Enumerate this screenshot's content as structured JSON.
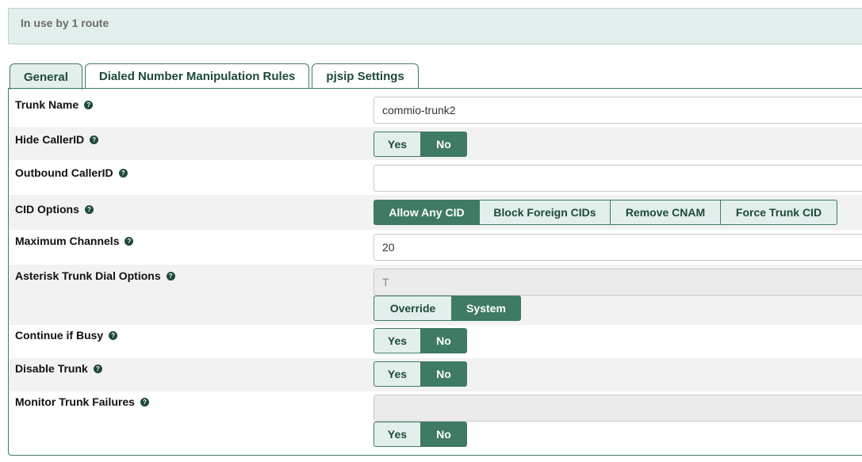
{
  "banner": {
    "text": "In use by 1 route"
  },
  "tabs": [
    {
      "label": "General",
      "active": true
    },
    {
      "label": "Dialed Number Manipulation Rules",
      "active": false
    },
    {
      "label": "pjsip Settings",
      "active": false
    }
  ],
  "help_glyph": "?",
  "fields": {
    "trunk_name": {
      "label": "Trunk Name",
      "value": "commio-trunk2"
    },
    "hide_callerid": {
      "label": "Hide CallerID",
      "options": [
        "Yes",
        "No"
      ],
      "selected": "No"
    },
    "outbound_callerid": {
      "label": "Outbound CallerID",
      "value": ""
    },
    "cid_options": {
      "label": "CID Options",
      "options": [
        "Allow Any CID",
        "Block Foreign CIDs",
        "Remove CNAM",
        "Force Trunk CID"
      ],
      "selected": "Allow Any CID"
    },
    "max_channels": {
      "label": "Maximum Channels",
      "value": "20"
    },
    "dial_options": {
      "label": "Asterisk Trunk Dial Options",
      "value": "T",
      "options": [
        "Override",
        "System"
      ],
      "selected": "System"
    },
    "continue_if_busy": {
      "label": "Continue if Busy",
      "options": [
        "Yes",
        "No"
      ],
      "selected": "No"
    },
    "disable_trunk": {
      "label": "Disable Trunk",
      "options": [
        "Yes",
        "No"
      ],
      "selected": "No"
    },
    "monitor_failures": {
      "label": "Monitor Trunk Failures",
      "value": "",
      "options": [
        "Yes",
        "No"
      ],
      "selected": "No"
    }
  },
  "colors": {
    "accent": "#3f7a62",
    "accent_light": "#e3efed",
    "row_shade": "#f2f2f2"
  }
}
